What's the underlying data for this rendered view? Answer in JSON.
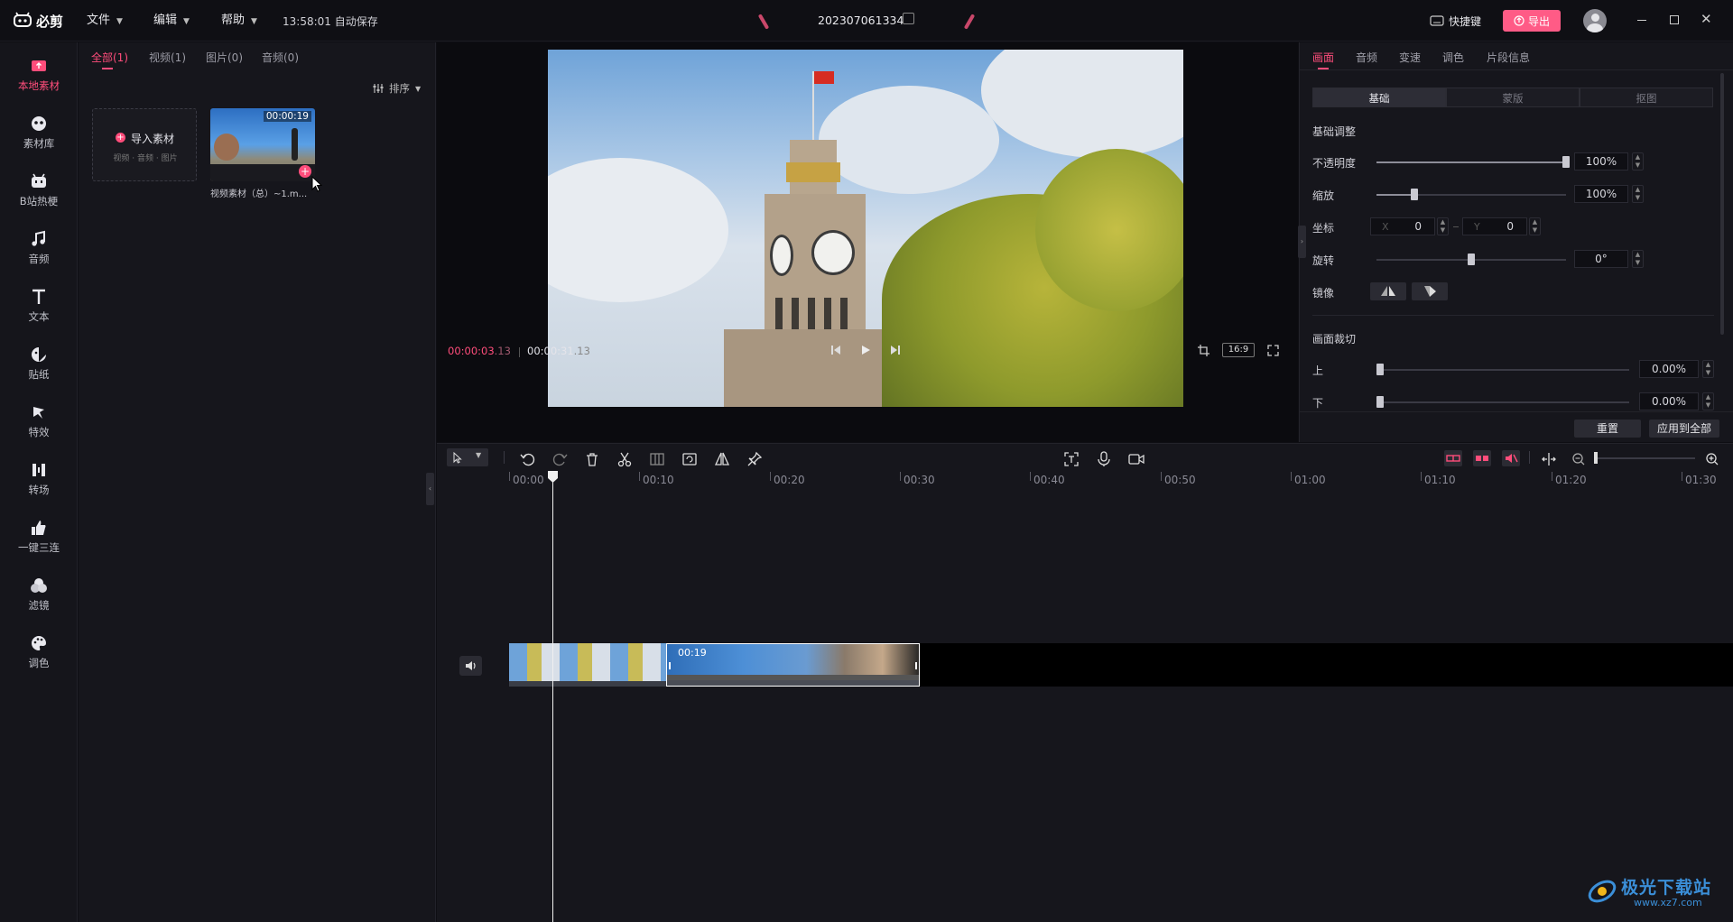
{
  "app": {
    "logo_text": "必剪",
    "menus": [
      "文件",
      "编辑",
      "帮助"
    ],
    "autosave": "13:58:01 自动保存",
    "project_name": "202307061334",
    "shortcut_label": "快捷键",
    "export_label": "导出",
    "accent": "#ff4d7b"
  },
  "sidebar": {
    "items": [
      {
        "label": "本地素材",
        "icon": "local-media-icon"
      },
      {
        "label": "素材库",
        "icon": "library-icon"
      },
      {
        "label": "B站热梗",
        "icon": "bilibili-icon"
      },
      {
        "label": "音频",
        "icon": "music-icon"
      },
      {
        "label": "文本",
        "icon": "text-icon"
      },
      {
        "label": "贴纸",
        "icon": "sticker-icon"
      },
      {
        "label": "特效",
        "icon": "effects-icon"
      },
      {
        "label": "转场",
        "icon": "transition-icon"
      },
      {
        "label": "一键三连",
        "icon": "thumbs-up-icon"
      },
      {
        "label": "滤镜",
        "icon": "filter-icon"
      },
      {
        "label": "调色",
        "icon": "palette-icon"
      }
    ]
  },
  "media": {
    "tabs": [
      "全部(1)",
      "视频(1)",
      "图片(0)",
      "音频(0)"
    ],
    "sort_label": "排序",
    "import_label": "导入素材",
    "import_hint": "视频 · 音频 · 图片",
    "clip_duration": "00:00:19",
    "clip_name": "视频素材（总）~1.m..."
  },
  "player": {
    "current_time_main": "00:00:03",
    "current_time_frac": ".13",
    "total_time_main": "00:00:31",
    "total_time_frac": ".13",
    "aspect": "16:9"
  },
  "props": {
    "tabs": [
      "画面",
      "音频",
      "变速",
      "调色",
      "片段信息"
    ],
    "segments": [
      "基础",
      "蒙版",
      "抠图"
    ],
    "section_basic": "基础调整",
    "opacity_label": "不透明度",
    "opacity_value": "100%",
    "scale_label": "缩放",
    "scale_value": "100%",
    "position_label": "坐标",
    "x_label": "X",
    "x_value": "0",
    "y_label": "Y",
    "y_value": "0",
    "rotate_label": "旋转",
    "rotate_value": "0°",
    "mirror_label": "镜像",
    "section_crop": "画面裁切",
    "crop_top_label": "上",
    "crop_top_value": "0.00%",
    "crop_bottom_label": "下",
    "crop_bottom_value": "0.00%",
    "reset_label": "重置",
    "apply_all_label": "应用到全部",
    "opacity_level": 1.0,
    "scale_level": 0.2,
    "rotate_level": 0.5
  },
  "timeline": {
    "ticks": [
      "00:00",
      "00:10",
      "00:20",
      "00:30",
      "00:40",
      "00:50",
      "01:00",
      "01:10",
      "01:20",
      "01:30"
    ],
    "clip_label": "00:19"
  },
  "watermark": {
    "text": "极光下载站",
    "url": "www.xz7.com"
  }
}
